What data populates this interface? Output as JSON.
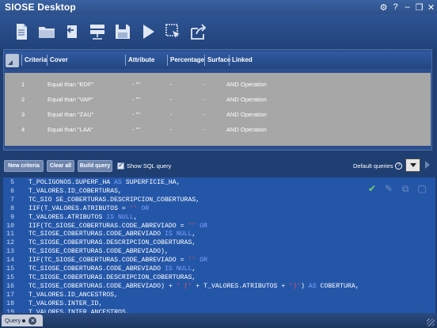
{
  "app": {
    "title": "SIOSE Desktop"
  },
  "titlebar": {
    "controls": [
      "⚙",
      "?",
      "–",
      "❐",
      "✕"
    ]
  },
  "toolbar": {
    "icons": [
      "new-document-icon",
      "open-folder-icon",
      "undo-icon",
      "server-icon",
      "save-icon",
      "run-icon",
      "select-icon",
      "export-icon"
    ]
  },
  "table": {
    "headers": {
      "criteria": "Criteria",
      "cover": "Cover",
      "attribute": "Attribute",
      "percentage": "Percentage",
      "surface": "Surface",
      "linked": "Linked"
    },
    "rows": [
      {
        "criteria": "1",
        "cover": "Equal than \"EDF\"",
        "attribute": "- \"\"",
        "percentage": "-",
        "surface": "-",
        "linked": "AND Operation"
      },
      {
        "criteria": "2",
        "cover": "Equal than \"VAP\"",
        "attribute": "- \"\"",
        "percentage": "-",
        "surface": "-",
        "linked": "AND Operation"
      },
      {
        "criteria": "3",
        "cover": "Equal than \"ZAU\"",
        "attribute": "- \"\"",
        "percentage": "-",
        "surface": "-",
        "linked": "AND Operation"
      },
      {
        "criteria": "4",
        "cover": "Equal than \"LAA\"",
        "attribute": "- \"\"",
        "percentage": "-",
        "surface": "-",
        "linked": "AND Operation"
      }
    ]
  },
  "actions": {
    "new_criteria": "New criteria",
    "clear_all": "Clear all",
    "build_query": "Build query",
    "show_sql": "Show SQL query",
    "default_queries": "Default queries",
    "help": "?"
  },
  "sql": {
    "lines": [
      {
        "n": "5",
        "segments": [
          [
            "T_POLIGONOS.SUPERF_HA ",
            ""
          ],
          [
            "AS",
            "kw"
          ],
          [
            " SUPERFICIE_HA,",
            ""
          ]
        ]
      },
      {
        "n": "6",
        "segments": [
          [
            "T_VALORES.ID_COBERTURAS,",
            ""
          ]
        ]
      },
      {
        "n": "7",
        "segments": [
          [
            "TC_SIO SE_COBERTURAS.DESCRIPCION_COBERTURAS,",
            ""
          ]
        ]
      },
      {
        "n": "8",
        "segments": [
          [
            "IIF(T_VALORES.ATRIBUTOS = ",
            ""
          ],
          [
            "''",
            "red"
          ],
          [
            " OR",
            "kw"
          ]
        ]
      },
      {
        "n": "9",
        "segments": [
          [
            "T_VALORES.ATRIBUTOS ",
            ""
          ],
          [
            "IS NULL",
            "kw"
          ],
          [
            ",",
            ""
          ]
        ]
      },
      {
        "n": "10",
        "segments": [
          [
            "IIF(TC_SIOSE_COBERTURAS.CODE_ABREVIADO = ",
            ""
          ],
          [
            "''",
            "red"
          ],
          [
            " OR",
            "kw"
          ]
        ]
      },
      {
        "n": "11",
        "segments": [
          [
            "TC_SIOSE_COBERTURAS.CODE_ABREVIADO ",
            ""
          ],
          [
            "IS NULL",
            "kw"
          ],
          [
            ",",
            ""
          ]
        ]
      },
      {
        "n": "12",
        "segments": [
          [
            "TC_SIOSE_COBERTURAS.DESCRIPCION_COBERTURAS,",
            ""
          ]
        ]
      },
      {
        "n": "13",
        "segments": [
          [
            "TC_SIOSE_COBERTURAS.CODE_ABREVIADO),",
            ""
          ]
        ]
      },
      {
        "n": "14",
        "segments": [
          [
            "IIF(TC_SIOSE_COBERTURAS.CODE_ABREVIADO = ",
            ""
          ],
          [
            "''",
            "red"
          ],
          [
            " OR",
            "kw"
          ]
        ]
      },
      {
        "n": "15",
        "segments": [
          [
            "TC_SIOSE_COBERTURAS.CODE_ABREVIADO ",
            ""
          ],
          [
            "IS NULL",
            "kw"
          ],
          [
            ",",
            ""
          ]
        ]
      },
      {
        "n": "15",
        "segments": [
          [
            "TC_SIOSE_COBERTURAS.DESCRIPCION_COBERTURAS,",
            ""
          ]
        ]
      },
      {
        "n": "16",
        "segments": [
          [
            "TC_SIOSE_COBERTURAS.CODE_ABREVIADO) + ",
            ""
          ],
          [
            "' ('",
            "red"
          ],
          [
            " + T_VALORES.ATRIBUTOS + ",
            ""
          ],
          [
            "')'",
            "red"
          ],
          [
            ") ",
            ""
          ],
          [
            "AS",
            "kw"
          ],
          [
            " COBERTURA,",
            ""
          ]
        ]
      },
      {
        "n": "17",
        "segments": [
          [
            "T_VALORES.ID_ANCESTROS,",
            ""
          ]
        ]
      },
      {
        "n": "18",
        "segments": [
          [
            "T_VALORES.INTER_ID,",
            ""
          ]
        ]
      },
      {
        "n": "19",
        "segments": [
          [
            "T_VALORES.INTER_ANCESTROS,",
            ""
          ]
        ]
      }
    ]
  },
  "status": {
    "tab_label": "Query"
  }
}
